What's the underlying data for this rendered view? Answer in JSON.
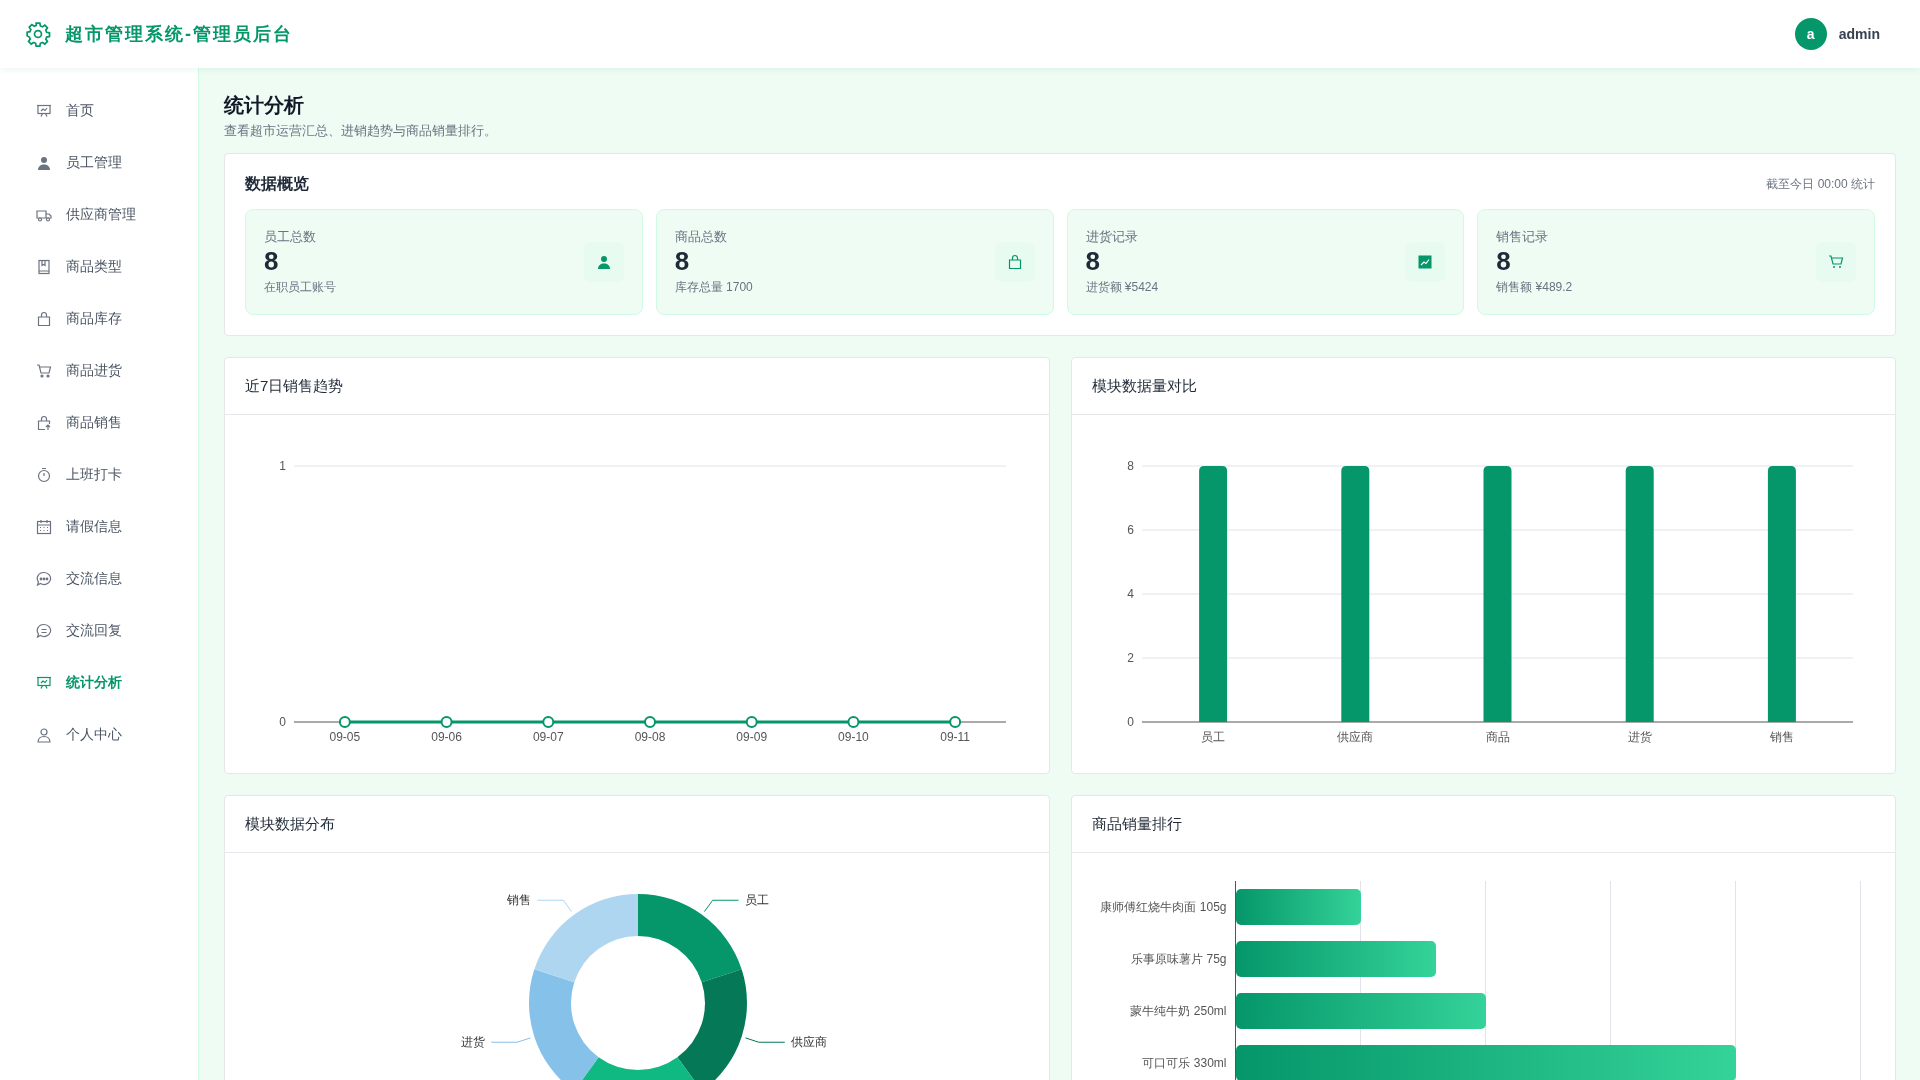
{
  "header": {
    "title": "超市管理系统-管理员后台",
    "user": {
      "avatar_letter": "a",
      "name": "admin"
    }
  },
  "sidebar": {
    "items": [
      {
        "label": "首页",
        "selected": false
      },
      {
        "label": "员工管理",
        "selected": false
      },
      {
        "label": "供应商管理",
        "selected": false
      },
      {
        "label": "商品类型",
        "selected": false
      },
      {
        "label": "商品库存",
        "selected": false
      },
      {
        "label": "商品进货",
        "selected": false
      },
      {
        "label": "商品销售",
        "selected": false
      },
      {
        "label": "上班打卡",
        "selected": false
      },
      {
        "label": "请假信息",
        "selected": false
      },
      {
        "label": "交流信息",
        "selected": false
      },
      {
        "label": "交流回复",
        "selected": false
      },
      {
        "label": "统计分析",
        "selected": true
      },
      {
        "label": "个人中心",
        "selected": false
      }
    ]
  },
  "page": {
    "title": "统计分析",
    "subtitle": "查看超市运营汇总、进销趋势与商品销量排行。"
  },
  "overview": {
    "title": "数据概览",
    "note": "截至今日 00:00 统计",
    "cards": [
      {
        "label": "员工总数",
        "value": "8",
        "detail": "在职员工账号"
      },
      {
        "label": "商品总数",
        "value": "8",
        "detail": "库存总量 1700"
      },
      {
        "label": "进货记录",
        "value": "8",
        "detail": "进货额 ¥5424"
      },
      {
        "label": "销售记录",
        "value": "8",
        "detail": "销售额 ¥489.2"
      }
    ]
  },
  "sales_trend": {
    "title": "近7日销售趋势",
    "chart_data": {
      "type": "line",
      "categories": [
        "09-05",
        "09-06",
        "09-07",
        "09-08",
        "09-09",
        "09-10",
        "09-11"
      ],
      "series": [
        {
          "color": "#059669",
          "marker": "circle",
          "values": [
            0,
            0,
            0,
            0,
            0,
            0,
            0
          ]
        }
      ],
      "ylim": [
        0,
        1
      ],
      "yticks": [
        0,
        1
      ],
      "grid": true
    }
  },
  "module_compare": {
    "title": "模块数据量对比",
    "chart_data": {
      "type": "bar",
      "categories": [
        "员工",
        "供应商",
        "商品",
        "进货",
        "销售"
      ],
      "series": [
        {
          "color": "#059669",
          "values": [
            8,
            8,
            8,
            8,
            8
          ]
        }
      ],
      "ylim": [
        0,
        8
      ],
      "yticks": [
        0,
        2,
        4,
        6,
        8
      ],
      "grid": true
    }
  },
  "module_distribution": {
    "title": "模块数据分布",
    "slices": [
      {
        "label": "员工",
        "color": "#059669"
      },
      {
        "label": "供应商",
        "color": "#047857"
      },
      {
        "color": "#10b981"
      },
      {
        "label": "进货",
        "color": "#85c1e9"
      },
      {
        "label": "销售",
        "color": "#aed6f1"
      }
    ]
  },
  "ranking": {
    "title": "商品销量排行",
    "bars": [
      {
        "label": "康师傅红烧牛肉面 105g",
        "level": 0.2
      },
      {
        "label": "乐事原味薯片 75g",
        "level": 0.32
      },
      {
        "label": "蒙牛纯牛奶 250ml",
        "level": 0.4
      },
      {
        "label": "可口可乐 330ml",
        "level": 0.8
      }
    ]
  }
}
